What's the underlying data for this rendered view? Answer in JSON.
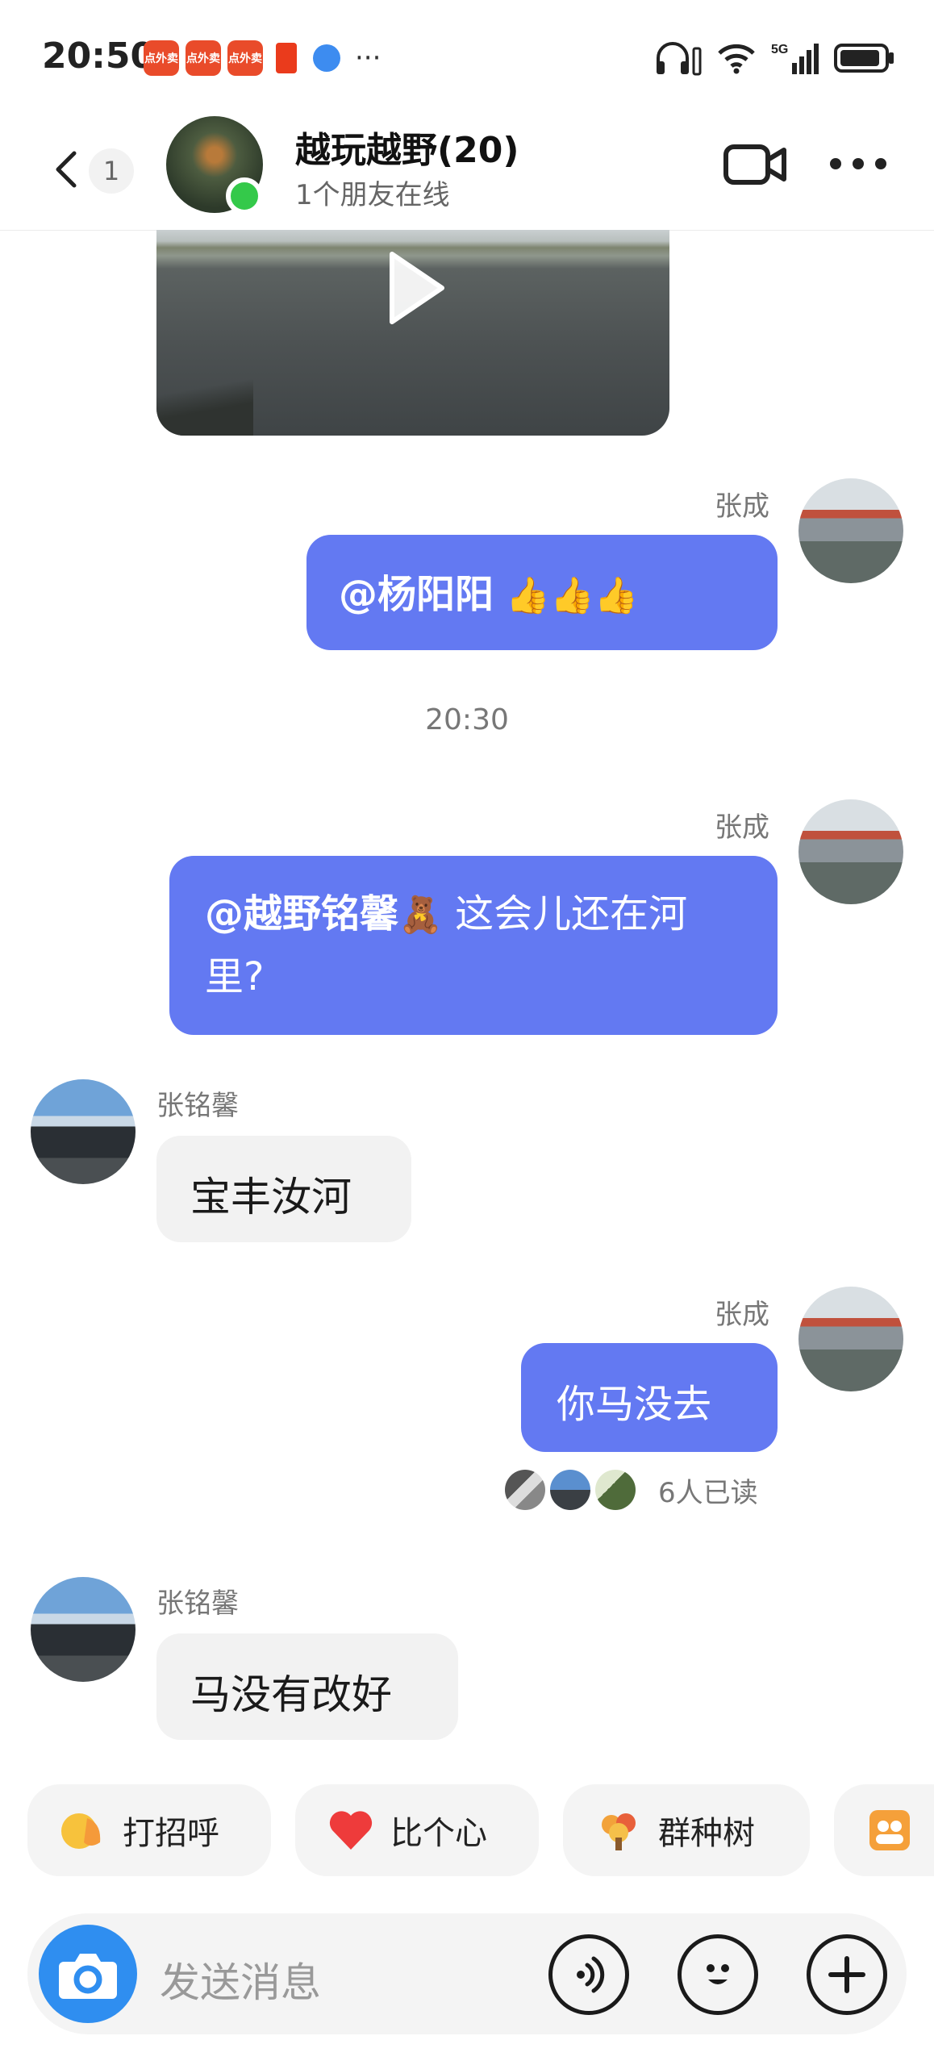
{
  "status_bar": {
    "time": "20:50",
    "notif_app_label": "点外卖",
    "more": "···",
    "network": "5G"
  },
  "header": {
    "back_count": "1",
    "title": "越玩越野(20)",
    "subtitle": "1个朋友在线"
  },
  "messages": [
    {
      "type": "video",
      "sender": "",
      "direction": "in"
    },
    {
      "type": "text",
      "sender": "张成",
      "direction": "out",
      "mention": "@杨阳阳",
      "emoji": "👍👍👍",
      "text": ""
    },
    {
      "type": "time",
      "text": "20:30"
    },
    {
      "type": "text",
      "sender": "张成",
      "direction": "out",
      "mention": "@越野铭馨",
      "emoji": "🧸",
      "text": " 这会儿还在河里?"
    },
    {
      "type": "text",
      "sender": "张铭馨",
      "direction": "in",
      "text": "宝丰汝河"
    },
    {
      "type": "text",
      "sender": "张成",
      "direction": "out",
      "text": "你马没去"
    },
    {
      "type": "read",
      "text": "6人已读"
    },
    {
      "type": "text",
      "sender": "张铭馨",
      "direction": "in",
      "text": "马没有改好"
    }
  ],
  "quick_actions": [
    {
      "label": "打招呼",
      "icon": "wave-hand-icon"
    },
    {
      "label": "比个心",
      "icon": "heart-icon"
    },
    {
      "label": "群种树",
      "icon": "tree-icon"
    },
    {
      "label": "",
      "icon": "group-photo-icon"
    }
  ],
  "input": {
    "placeholder": "发送消息"
  },
  "colors": {
    "out_bubble": "#6379f2",
    "in_bubble": "#f2f2f2",
    "camera": "#2f8ef0",
    "online": "#34c94a"
  }
}
